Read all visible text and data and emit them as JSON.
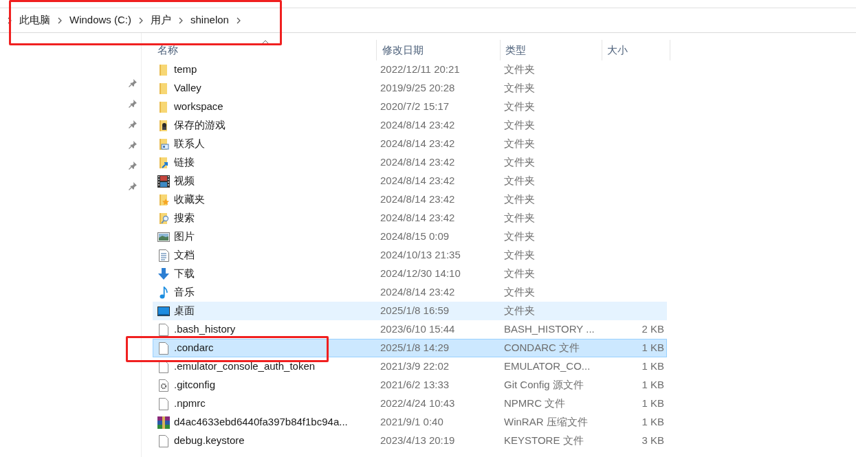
{
  "breadcrumb": [
    "此电脑",
    "Windows (C:)",
    "用户",
    "shinelon"
  ],
  "quick_access": [
    {
      "pinned": true
    },
    {
      "pinned": true
    },
    {
      "pinned": true
    },
    {
      "pinned": true
    },
    {
      "pinned": true
    },
    {
      "pinned": true
    }
  ],
  "table": {
    "columns": [
      {
        "label": "名称",
        "sorted": true
      },
      {
        "label": "修改日期",
        "sorted": false
      },
      {
        "label": "类型",
        "sorted": false
      },
      {
        "label": "大小",
        "sorted": false
      }
    ],
    "rows": [
      {
        "kind": "folder",
        "name": "temp",
        "date": "2022/12/11 20:21",
        "type": "文件夹",
        "selected": false,
        "hovered": false
      },
      {
        "kind": "folder",
        "name": "Valley",
        "date": "2019/9/25 20:28",
        "type": "文件夹",
        "selected": false,
        "hovered": false
      },
      {
        "kind": "folder",
        "name": "workspace",
        "date": "2020/7/2 15:17",
        "type": "文件夹",
        "selected": false,
        "hovered": false
      },
      {
        "kind": "games",
        "name": "保存的游戏",
        "date": "2024/8/14 23:42",
        "type": "文件夹",
        "selected": false,
        "hovered": false
      },
      {
        "kind": "contacts",
        "name": "联系人",
        "date": "2024/8/14 23:42",
        "type": "文件夹",
        "selected": false,
        "hovered": false
      },
      {
        "kind": "links",
        "name": "链接",
        "date": "2024/8/14 23:42",
        "type": "文件夹",
        "selected": false,
        "hovered": false
      },
      {
        "kind": "video",
        "name": "视频",
        "date": "2024/8/14 23:42",
        "type": "文件夹",
        "selected": false,
        "hovered": false
      },
      {
        "kind": "favorites",
        "name": "收藏夹",
        "date": "2024/8/14 23:42",
        "type": "文件夹",
        "selected": false,
        "hovered": false
      },
      {
        "kind": "searches",
        "name": "搜索",
        "date": "2024/8/14 23:42",
        "type": "文件夹",
        "selected": false,
        "hovered": false
      },
      {
        "kind": "pictures",
        "name": "图片",
        "date": "2024/8/15 0:09",
        "type": "文件夹",
        "selected": false,
        "hovered": false
      },
      {
        "kind": "documents",
        "name": "文档",
        "date": "2024/10/13 21:35",
        "type": "文件夹",
        "selected": false,
        "hovered": false
      },
      {
        "kind": "downloads",
        "name": "下载",
        "date": "2024/12/30 14:10",
        "type": "文件夹",
        "selected": false,
        "hovered": false
      },
      {
        "kind": "music",
        "name": "音乐",
        "date": "2024/8/14 23:42",
        "type": "文件夹",
        "selected": false,
        "hovered": false
      },
      {
        "kind": "desktop",
        "name": "桌面",
        "date": "2025/1/8 16:59",
        "type": "文件夹",
        "selected": false,
        "hovered": true
      },
      {
        "kind": "file",
        "name": ".bash_history",
        "date": "2023/6/10 15:44",
        "type": "BASH_HISTORY ...",
        "size": "2 KB",
        "selected": false,
        "hovered": false
      },
      {
        "kind": "file",
        "name": ".condarc",
        "date": "2025/1/8 14:29",
        "type": "CONDARC 文件",
        "size": "1 KB",
        "selected": true,
        "hovered": false
      },
      {
        "kind": "file",
        "name": ".emulator_console_auth_token",
        "date": "2021/3/9 22:02",
        "type": "EMULATOR_CO...",
        "size": "1 KB",
        "selected": false,
        "hovered": false
      },
      {
        "kind": "config",
        "name": ".gitconfig",
        "date": "2021/6/2 13:33",
        "type": "Git Config 源文件",
        "size": "1 KB",
        "selected": false,
        "hovered": false
      },
      {
        "kind": "file",
        "name": ".npmrc",
        "date": "2022/4/24 10:43",
        "type": "NPMRC 文件",
        "size": "1 KB",
        "selected": false,
        "hovered": false
      },
      {
        "kind": "archive",
        "name": "d4ac4633ebd6440fa397b84f1bc94a...",
        "date": "2021/9/1 0:40",
        "type": "WinRAR 压缩文件",
        "size": "1 KB",
        "selected": false,
        "hovered": false
      },
      {
        "kind": "file",
        "name": "debug.keystore",
        "date": "2023/4/13 20:19",
        "type": "KEYSTORE 文件",
        "size": "3 KB",
        "selected": false,
        "hovered": false
      }
    ]
  }
}
